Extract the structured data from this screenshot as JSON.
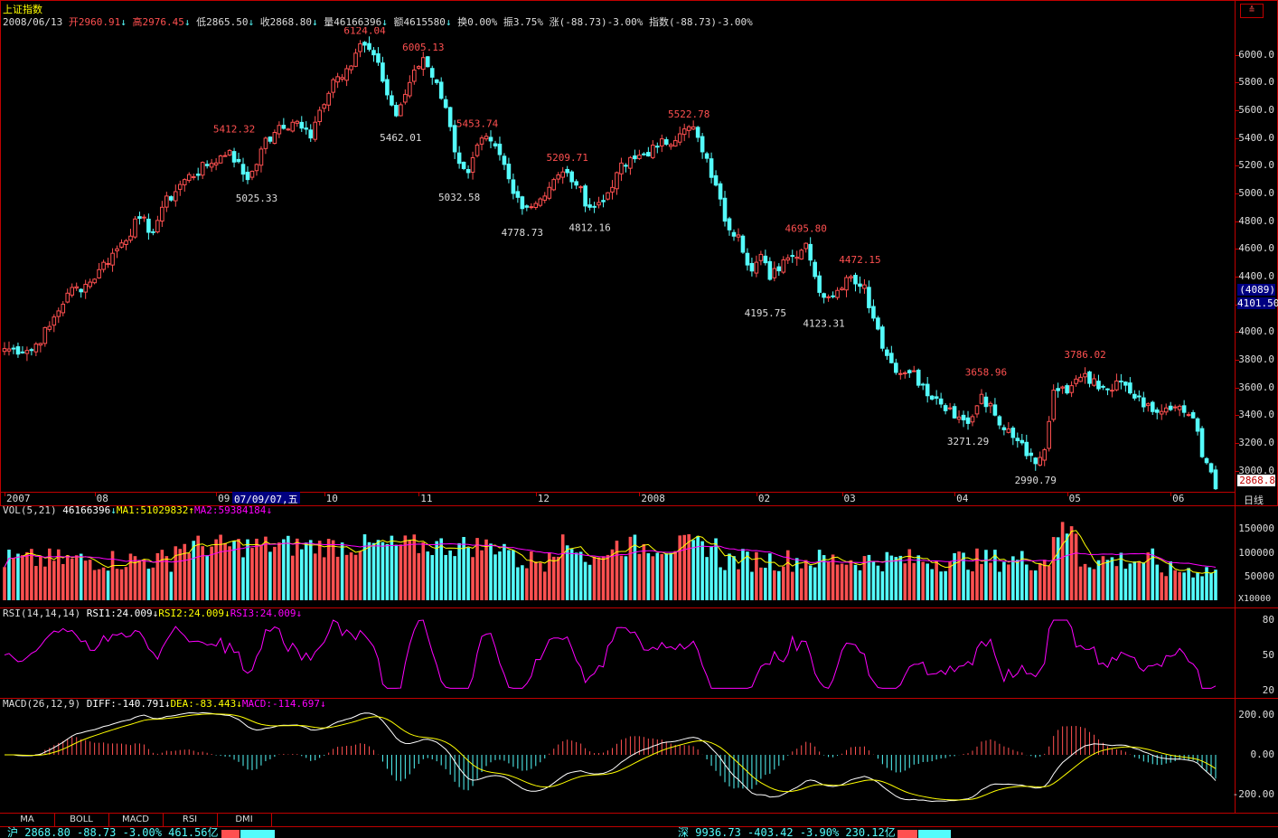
{
  "colors": {
    "up": "#ff5050",
    "down": "#54fcfc",
    "bg": "#000000",
    "frame": "#c00000",
    "ma1": "#ffff00",
    "ma2": "#ff00ff",
    "diff": "#ffffff",
    "dea": "#ffff00",
    "highlight": "#000080"
  },
  "title": "上证指数",
  "info": {
    "date": "2008/06/13",
    "open": "开2960.91",
    "high": "高2976.45",
    "low": "低2865.50",
    "close": "收2868.80",
    "volume": "量46166396",
    "amount": "额4615580",
    "turnover": "换0.00%",
    "amplitude": "振3.75%",
    "change": "涨(-88.73)-3.00%",
    "index": "指数(-88.73)-3.00%"
  },
  "top_right_icon": "menu-icon",
  "price_axis": {
    "labels": [
      "6000.0",
      "5800.0",
      "5600.0",
      "5400.0",
      "5200.0",
      "5000.0",
      "4800.0",
      "4600.0",
      "4400.0",
      "4200.0",
      "4000.0",
      "3800.0",
      "3600.0",
      "3400.0",
      "3200.0",
      "3000.0"
    ],
    "cursor_label": "(4089)",
    "cursor_value": "4101.50",
    "last_value": "2868.8"
  },
  "annotations": {
    "peaks": [
      {
        "text": "6124.04",
        "i": 80
      },
      {
        "text": "6005.13",
        "i": 93
      },
      {
        "text": "5412.32",
        "i": 51
      },
      {
        "text": "5453.74",
        "i": 105
      },
      {
        "text": "5209.71",
        "i": 125
      },
      {
        "text": "5522.78",
        "i": 152
      },
      {
        "text": "4695.80",
        "i": 178
      },
      {
        "text": "4472.15",
        "i": 190
      },
      {
        "text": "3658.96",
        "i": 218
      },
      {
        "text": "3786.02",
        "i": 240
      }
    ],
    "troughs": [
      {
        "text": "5462.01",
        "i": 88
      },
      {
        "text": "5025.33",
        "i": 56
      },
      {
        "text": "5032.58",
        "i": 101
      },
      {
        "text": "4778.73",
        "i": 115
      },
      {
        "text": "4812.16",
        "i": 130
      },
      {
        "text": "4195.75",
        "i": 169
      },
      {
        "text": "4123.31",
        "i": 182
      },
      {
        "text": "3271.29",
        "i": 214
      },
      {
        "text": "2990.79",
        "i": 229
      }
    ]
  },
  "date_axis": {
    "labels": [
      {
        "t": "2007",
        "i": 0
      },
      {
        "t": "08",
        "i": 20
      },
      {
        "t": "09",
        "i": 47
      },
      {
        "t": "10",
        "i": 71
      },
      {
        "t": "11",
        "i": 92
      },
      {
        "t": "12",
        "i": 118
      },
      {
        "t": "2008",
        "i": 141
      },
      {
        "t": "02",
        "i": 167
      },
      {
        "t": "03",
        "i": 186
      },
      {
        "t": "04",
        "i": 211
      },
      {
        "t": "05",
        "i": 236
      },
      {
        "t": "06",
        "i": 259
      }
    ],
    "cursor_date": "07/09/07,五",
    "period": "日线"
  },
  "vol": {
    "header": {
      "name": "VOL(5,21)",
      "value": "46166396",
      "ma1": "MA1:51029832",
      "ma2": "MA2:59384184"
    },
    "axis": [
      "150000",
      "100000",
      "50000"
    ],
    "unit": "X10000"
  },
  "rsi": {
    "header": {
      "name": "RSI(14,14,14)",
      "rsi1": "RSI1:24.009",
      "rsi2": "RSI2:24.009",
      "rsi3": "RSI3:24.009"
    },
    "axis": [
      "80",
      "50",
      "20"
    ]
  },
  "macd": {
    "header": {
      "name": "MACD(26,12,9)",
      "diff": "DIFF:-140.791",
      "dea": "DEA:-83.443",
      "macd": "MACD:-114.697"
    },
    "axis": [
      "200.00",
      "0.00",
      "-200.00"
    ]
  },
  "tabs": [
    "MA",
    "BOLL",
    "MACD",
    "RSI",
    "DMI"
  ],
  "status": {
    "sh": "沪 2868.80 -88.73 -3.00% 461.56亿",
    "sz": "深 9936.73 -403.42 -3.90% 230.12亿"
  },
  "chart_data": {
    "type": "candlestick",
    "title": "上证指数",
    "count": 270,
    "price_range": [
      2860,
      6200
    ],
    "anchors": [
      [
        0,
        3880
      ],
      [
        6,
        3870
      ],
      [
        10,
        4040
      ],
      [
        14,
        4280
      ],
      [
        19,
        4360
      ],
      [
        21,
        4450
      ],
      [
        25,
        4600
      ],
      [
        30,
        4820
      ],
      [
        33,
        4720
      ],
      [
        35,
        4900
      ],
      [
        40,
        5100
      ],
      [
        45,
        5200
      ],
      [
        50,
        5310
      ],
      [
        54,
        5100
      ],
      [
        57,
        5320
      ],
      [
        60,
        5440
      ],
      [
        65,
        5520
      ],
      [
        68,
        5400
      ],
      [
        70,
        5600
      ],
      [
        73,
        5820
      ],
      [
        76,
        5900
      ],
      [
        79,
        6080
      ],
      [
        82,
        6000
      ],
      [
        84,
        5810
      ],
      [
        87,
        5560
      ],
      [
        90,
        5800
      ],
      [
        93,
        5980
      ],
      [
        96,
        5800
      ],
      [
        98,
        5620
      ],
      [
        100,
        5300
      ],
      [
        103,
        5150
      ],
      [
        106,
        5400
      ],
      [
        110,
        5280
      ],
      [
        113,
        5000
      ],
      [
        116,
        4900
      ],
      [
        119,
        4960
      ],
      [
        122,
        5100
      ],
      [
        125,
        5150
      ],
      [
        127,
        5060
      ],
      [
        130,
        4900
      ],
      [
        133,
        4940
      ],
      [
        136,
        5150
      ],
      [
        140,
        5250
      ],
      [
        145,
        5340
      ],
      [
        150,
        5430
      ],
      [
        153,
        5480
      ],
      [
        155,
        5300
      ],
      [
        158,
        5060
      ],
      [
        160,
        4800
      ],
      [
        163,
        4700
      ],
      [
        166,
        4440
      ],
      [
        168,
        4560
      ],
      [
        170,
        4380
      ],
      [
        173,
        4520
      ],
      [
        175,
        4550
      ],
      [
        178,
        4640
      ],
      [
        180,
        4400
      ],
      [
        182,
        4250
      ],
      [
        185,
        4300
      ],
      [
        188,
        4400
      ],
      [
        191,
        4340
      ],
      [
        193,
        4100
      ],
      [
        196,
        3830
      ],
      [
        199,
        3700
      ],
      [
        202,
        3720
      ],
      [
        205,
        3540
      ],
      [
        208,
        3480
      ],
      [
        211,
        3380
      ],
      [
        214,
        3340
      ],
      [
        217,
        3550
      ],
      [
        220,
        3400
      ],
      [
        223,
        3300
      ],
      [
        226,
        3200
      ],
      [
        229,
        3050
      ],
      [
        231,
        3150
      ],
      [
        233,
        3580
      ],
      [
        236,
        3560
      ],
      [
        238,
        3660
      ],
      [
        240,
        3700
      ],
      [
        243,
        3590
      ],
      [
        246,
        3580
      ],
      [
        248,
        3640
      ],
      [
        250,
        3560
      ],
      [
        253,
        3460
      ],
      [
        256,
        3420
      ],
      [
        259,
        3440
      ],
      [
        262,
        3420
      ],
      [
        264,
        3380
      ],
      [
        266,
        3100
      ],
      [
        268,
        2990
      ],
      [
        269,
        2868.8
      ]
    ],
    "volume": {
      "max": 150000,
      "unit": "X10000",
      "last": "46166396"
    },
    "rsi": {
      "range": [
        20,
        80
      ]
    },
    "macd": {
      "range": [
        -250,
        250
      ]
    }
  }
}
